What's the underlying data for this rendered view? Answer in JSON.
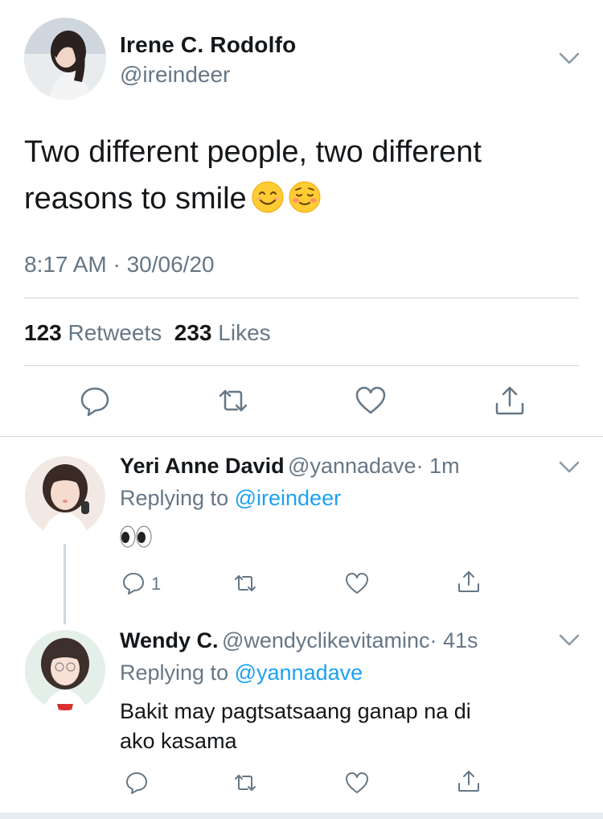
{
  "main_tweet": {
    "author_name": "Irene C. Rodolfo",
    "author_handle": "@ireindeer",
    "text": "Two different people, two different reasons to smile",
    "emojis": [
      "smiling-face-with-smiling-eyes",
      "smiling-face-blush"
    ],
    "timestamp": "8:17 AM · 30/06/20",
    "retweets_count": "123",
    "retweets_label": "Retweets",
    "likes_count": "233",
    "likes_label": "Likes",
    "actions": [
      "reply-icon",
      "retweet-icon",
      "like-icon",
      "share-icon"
    ]
  },
  "replies": [
    {
      "author_name": "Yeri Anne David",
      "author_handle": "@yannadave",
      "time": "· 1m",
      "replying_prefix": "Replying to",
      "replying_to": "@ireindeer",
      "body": "",
      "body_emoji": "eyes",
      "reply_count": "1"
    },
    {
      "author_name": "Wendy C.",
      "author_handle": "@wendyclikevitaminc",
      "time": "· 41s",
      "replying_prefix": "Replying to",
      "replying_to": "@yannadave",
      "body_line1": "Bakit may pagtsatsaang ganap na di",
      "body_line2": "ako kasama",
      "reply_count": ""
    }
  ],
  "colors": {
    "link": "#1da1f2",
    "muted": "#657786",
    "text": "#14171a",
    "divider": "#ccd6dd",
    "emoji": "#ffcc33"
  }
}
